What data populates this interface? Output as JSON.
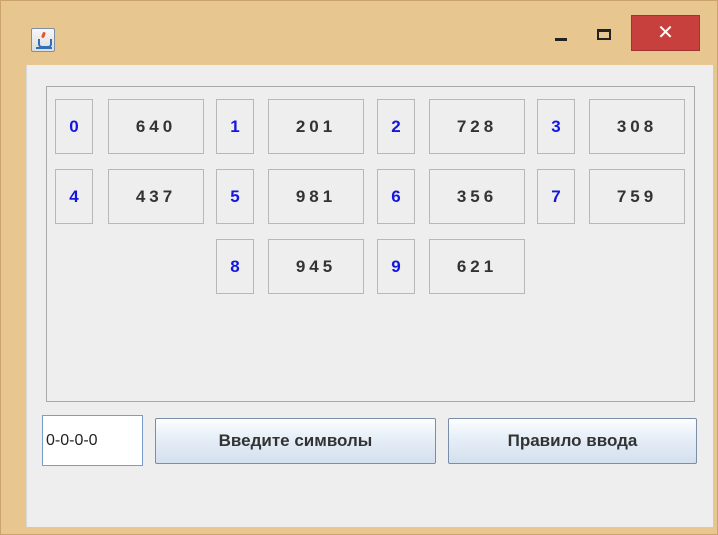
{
  "window": {
    "title": "",
    "controls": {
      "minimize": "minimize",
      "maximize": "maximize",
      "close": "✕"
    }
  },
  "grid": {
    "rows": [
      [
        {
          "index": "0",
          "value": "640"
        },
        {
          "index": "1",
          "value": "201"
        },
        {
          "index": "2",
          "value": "728"
        },
        {
          "index": "3",
          "value": "308"
        }
      ],
      [
        {
          "index": "4",
          "value": "437"
        },
        {
          "index": "5",
          "value": "981"
        },
        {
          "index": "6",
          "value": "356"
        },
        {
          "index": "7",
          "value": "759"
        }
      ],
      [
        {
          "index": "8",
          "value": "945"
        },
        {
          "index": "9",
          "value": "621"
        }
      ]
    ]
  },
  "input": {
    "value": "0-0-0-0"
  },
  "buttons": {
    "enter_label": "Введите символы",
    "rule_label": "Правило ввода"
  },
  "colors": {
    "index_text": "#1515e0",
    "title_bar": "#e8c690",
    "close_button": "#c7403d"
  }
}
